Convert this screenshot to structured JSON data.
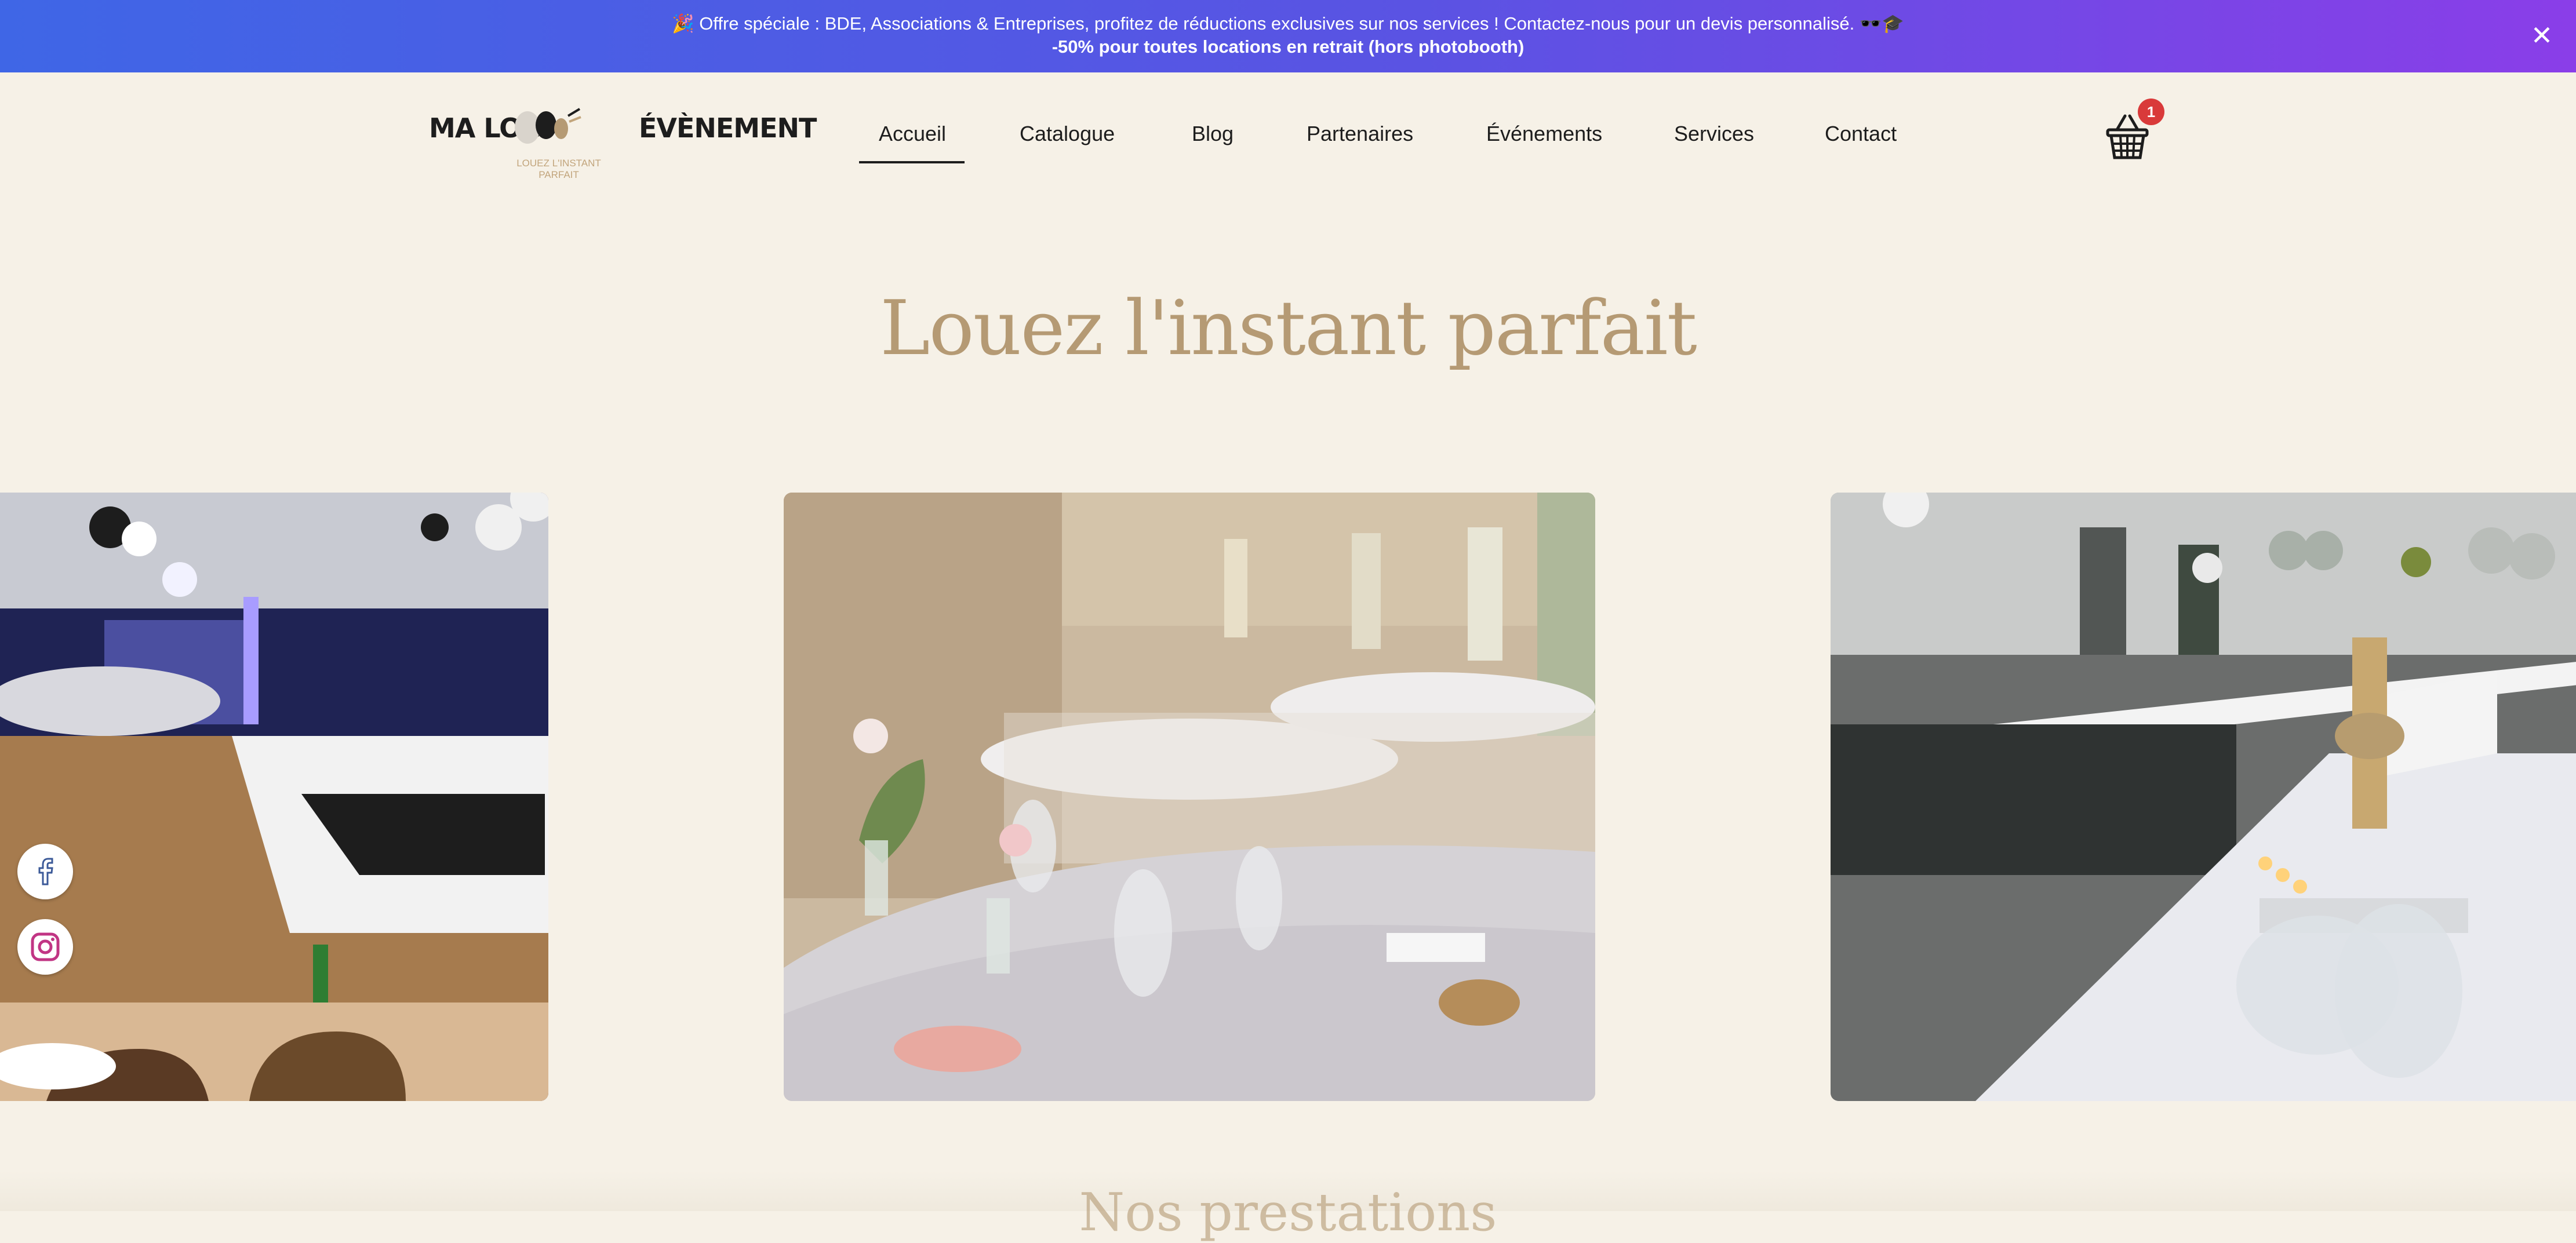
{
  "promo": {
    "line1": "🎉 Offre spéciale : BDE, Associations & Entreprises, profitez de réductions exclusives sur nos services ! Contactez-nous pour un devis personnalisé. 🕶️🎓",
    "line2": "-50% pour toutes locations en retrait (hors photobooth)",
    "close_icon": "close-icon",
    "gradient": [
      "#3f66e6",
      "#8a3ee8"
    ]
  },
  "header": {
    "logo_part1": "MA LOC",
    "logo_part2": "ÉVÈNEMENT",
    "logo_tagline": "LOUEZ L'INSTANT PARFAIT",
    "nav": [
      {
        "label": "Accueil",
        "active": true
      },
      {
        "label": "Catalogue"
      },
      {
        "label": "Blog"
      },
      {
        "label": "Partenaires"
      },
      {
        "label": "Événements"
      },
      {
        "label": "Services"
      },
      {
        "label": "Contact"
      }
    ],
    "cart_icon": "basket-icon",
    "cart_count": "1"
  },
  "hero": {
    "title": "Louez l'instant parfait",
    "slides": [
      {
        "icon": "photo-room-dj-icon"
      },
      {
        "icon": "photo-chateau-tables-icon"
      },
      {
        "icon": "photo-birthday-hall-icon"
      }
    ]
  },
  "social": [
    {
      "icon": "facebook-icon"
    },
    {
      "icon": "instagram-icon"
    }
  ],
  "next_section": {
    "title_partial": "Nos prestations"
  },
  "colors": {
    "background": "#f6f1e7",
    "accent": "#b59a74",
    "badge": "#d93a3a"
  }
}
